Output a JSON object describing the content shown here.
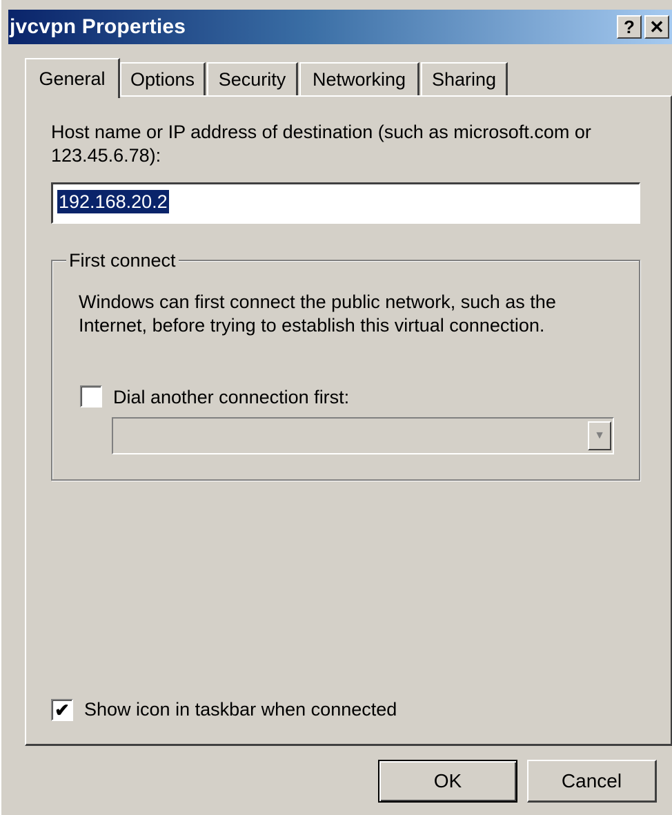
{
  "window": {
    "title": "jvcvpn Properties",
    "help_button": "?",
    "close_button": "✕"
  },
  "tabs": [
    {
      "label": "General",
      "active": true
    },
    {
      "label": "Options",
      "active": false
    },
    {
      "label": "Security",
      "active": false
    },
    {
      "label": "Networking",
      "active": false
    },
    {
      "label": "Sharing",
      "active": false
    }
  ],
  "general": {
    "host_label_line1": "Host name or IP address of destination (such as microsoft.com or",
    "host_label_line2": "123.45.6.78):",
    "host_value": "192.168.20.2",
    "first_connect": {
      "legend": "First connect",
      "desc_line1": "Windows can first connect the public network, such as the",
      "desc_line2": "Internet, before trying to establish this virtual connection.",
      "dial_label": "Dial another connection first:",
      "dial_checked": false,
      "dial_checkmark": "",
      "connection_value": ""
    },
    "show_icon_label": "Show icon in taskbar when connected",
    "show_icon_checked": true,
    "show_icon_checkmark": "✔"
  },
  "buttons": {
    "ok": "OK",
    "cancel": "Cancel"
  }
}
